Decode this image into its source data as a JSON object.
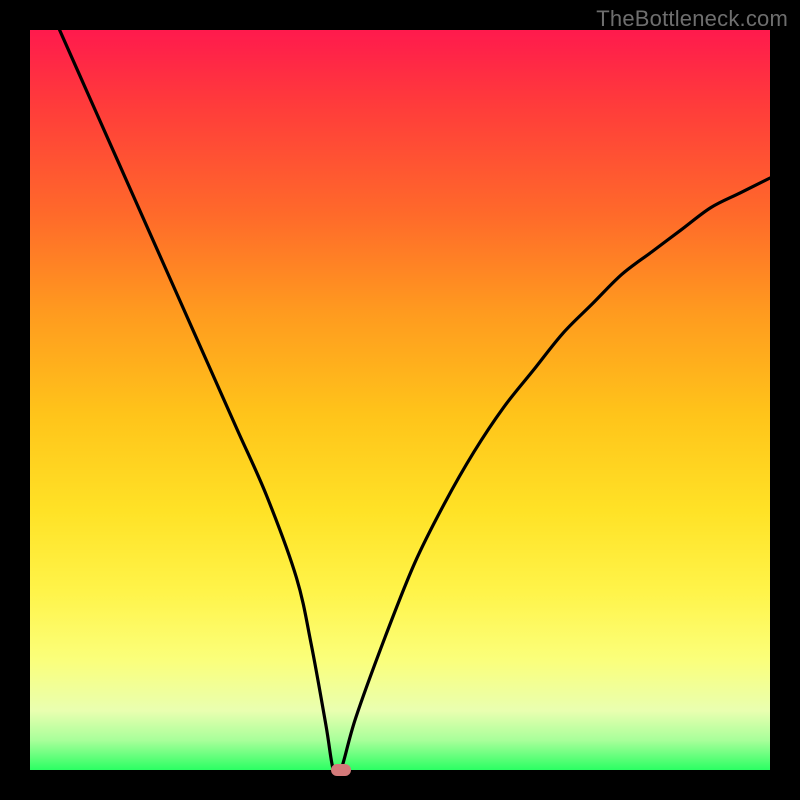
{
  "watermark": "TheBottleneck.com",
  "chart_data": {
    "type": "line",
    "title": "",
    "xlabel": "",
    "ylabel": "",
    "xlim": [
      0,
      100
    ],
    "ylim": [
      0,
      100
    ],
    "grid": false,
    "legend": false,
    "series": [
      {
        "name": "bottleneck-curve",
        "x": [
          4,
          8,
          12,
          16,
          20,
          24,
          28,
          32,
          36,
          38,
          40,
          41,
          42,
          44,
          48,
          52,
          56,
          60,
          64,
          68,
          72,
          76,
          80,
          84,
          88,
          92,
          96,
          100
        ],
        "y": [
          100,
          91,
          82,
          73,
          64,
          55,
          46,
          37,
          26,
          17,
          6,
          0,
          0,
          7,
          18,
          28,
          36,
          43,
          49,
          54,
          59,
          63,
          67,
          70,
          73,
          76,
          78,
          80
        ]
      }
    ],
    "marker": {
      "x": 42,
      "y": 0,
      "shape": "rounded-rect",
      "color": "#d47a7a"
    },
    "background_gradient": {
      "direction": "vertical",
      "stops": [
        {
          "pos": 0.0,
          "color": "#ff1a4d"
        },
        {
          "pos": 0.25,
          "color": "#ff6a2a"
        },
        {
          "pos": 0.52,
          "color": "#ffc41a"
        },
        {
          "pos": 0.76,
          "color": "#fff44a"
        },
        {
          "pos": 0.92,
          "color": "#e9ffb0"
        },
        {
          "pos": 1.0,
          "color": "#2bff63"
        }
      ]
    }
  }
}
